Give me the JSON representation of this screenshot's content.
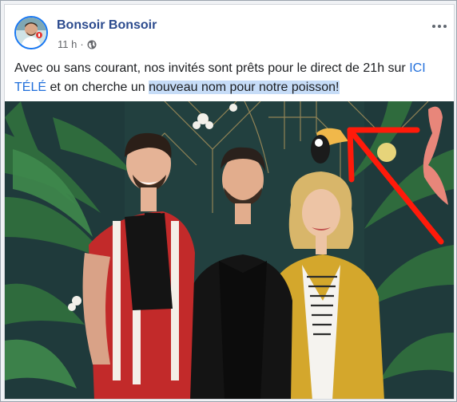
{
  "post": {
    "page_name": "Bonsoir Bonsoir",
    "time": "11 h",
    "separator": "·",
    "text_part1": "Avec ou sans courant, nos invités sont prêts pour le direct de 21h sur ",
    "text_link": "ICI TÉLÉ",
    "text_part2": " et on cherche un ",
    "text_highlight": "nouveau nom pour notre poisson!"
  },
  "colors": {
    "page_name": "#2c4b8e",
    "link": "#216fdb",
    "highlight": "#c6dcf7",
    "annotation_arrow": "#ff1a0a"
  },
  "icons": [
    "globe-icon",
    "more-options-icon"
  ]
}
